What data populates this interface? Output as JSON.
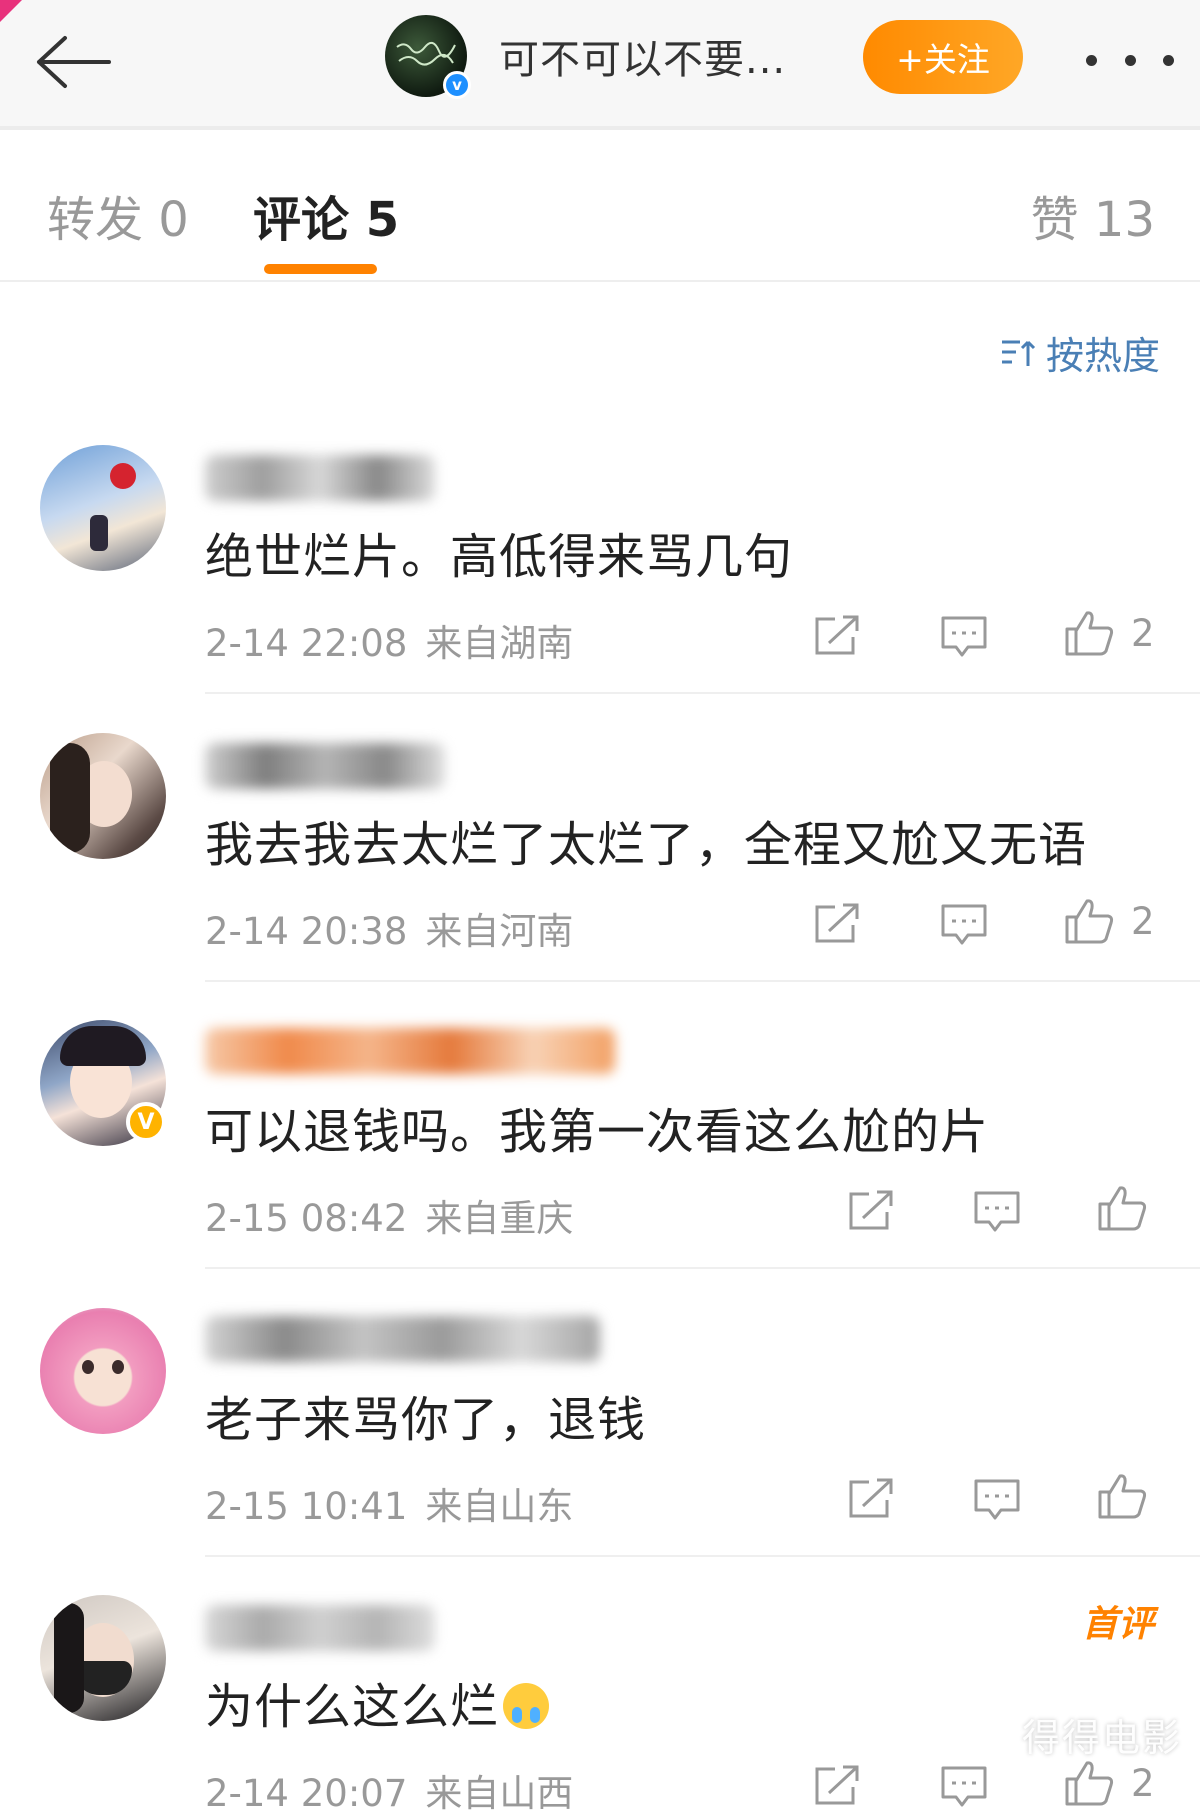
{
  "header": {
    "author_name": "可不可以不要...",
    "follow_label": "+关注"
  },
  "tabs": {
    "repost": "转发 0",
    "comment": "评论 5",
    "like": "赞 13"
  },
  "sort_label": "按热度",
  "comments": [
    {
      "text": "绝世烂片。高低得来骂几句",
      "time": "2-14 22:08",
      "location": "来自湖南",
      "likes": "2"
    },
    {
      "text": "我去我去太烂了太烂了，全程又尬又无语",
      "time": "2-14 20:38",
      "location": "来自河南",
      "likes": "2"
    },
    {
      "text": "可以退钱吗。我第一次看这么尬的片",
      "time": "2-15 08:42",
      "location": "来自重庆",
      "likes": ""
    },
    {
      "text": "老子来骂你了，退钱",
      "time": "2-15 10:41",
      "location": "来自山东",
      "likes": ""
    },
    {
      "text": "为什么这么烂",
      "time": "2-14 20:07",
      "location": "来自山西",
      "likes": "2",
      "tag": "首评"
    }
  ],
  "watermark": "得得电影",
  "colors": {
    "accent": "#ff8200",
    "link": "#4a7fb5",
    "meta": "#999999"
  },
  "icons": [
    "back-arrow-icon",
    "verified-icon",
    "more-icon",
    "sort-icon",
    "share-icon",
    "reply-icon",
    "thumb-up-icon",
    "crying-emoji-icon"
  ]
}
